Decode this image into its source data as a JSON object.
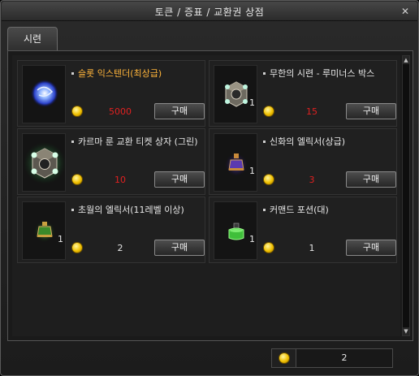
{
  "window": {
    "title": "토큰 / 증표 / 교환권 상점",
    "close_icon": "close-icon"
  },
  "tabs": [
    {
      "label": "시련",
      "active": true
    }
  ],
  "items": [
    {
      "name": "슬롯 익스텐더(최상급)",
      "highlight": true,
      "price": "5000",
      "price_color": "red",
      "quantity": "",
      "buy_label": "구매",
      "icon": "blue-orb-icon"
    },
    {
      "name": "무한의 시련 - 루미너스 박스",
      "highlight": false,
      "price": "15",
      "price_color": "red",
      "quantity": "1",
      "buy_label": "구매",
      "icon": "luminous-box-icon"
    },
    {
      "name": "카르마 룬 교환 티켓 상자 (그린)",
      "highlight": false,
      "price": "10",
      "price_color": "red",
      "quantity": "",
      "buy_label": "구매",
      "icon": "green-ticket-box-icon"
    },
    {
      "name": "신화의 엘릭서(상급)",
      "highlight": false,
      "price": "3",
      "price_color": "red",
      "quantity": "1",
      "buy_label": "구매",
      "icon": "purple-elixir-icon"
    },
    {
      "name": "초월의 엘릭서(11레벨 이상)",
      "highlight": false,
      "price": "2",
      "price_color": "white",
      "quantity": "1",
      "buy_label": "구매",
      "icon": "green-elixir-icon"
    },
    {
      "name": "커맨드 포션(대)",
      "highlight": false,
      "price": "1",
      "price_color": "white",
      "quantity": "1",
      "buy_label": "구매",
      "icon": "green-potion-icon"
    }
  ],
  "footer": {
    "balance": "2",
    "currency_icon": "coin-icon"
  },
  "colors": {
    "highlight_name": "#ffb43a",
    "price_red": "#e02020",
    "coin_gold": "#f0c000"
  }
}
